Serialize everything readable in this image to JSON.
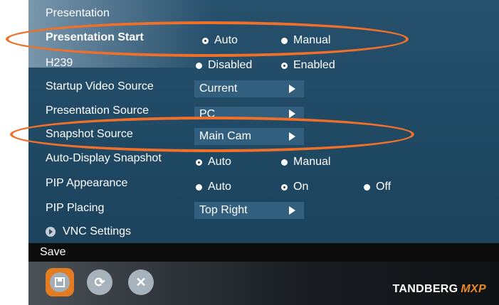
{
  "panel": {
    "title": "Presentation",
    "rows": [
      {
        "label": "Presentation Start",
        "bold": true,
        "options": [
          {
            "label": "Auto",
            "selected": true
          },
          {
            "label": "Manual",
            "selected": false
          }
        ]
      },
      {
        "label": "H239",
        "options": [
          {
            "label": "Disabled",
            "selected": false
          },
          {
            "label": "Enabled",
            "selected": true
          }
        ]
      },
      {
        "label": "Startup Video Source",
        "select": "Current"
      },
      {
        "label": "Presentation Source",
        "select": "PC"
      },
      {
        "label": "Snapshot Source",
        "select": "Main Cam"
      },
      {
        "label": "Auto-Display Snapshot",
        "options": [
          {
            "label": "Auto",
            "selected": true
          },
          {
            "label": "Manual",
            "selected": false
          }
        ]
      },
      {
        "label": "PIP Appearance",
        "options": [
          {
            "label": "Auto",
            "selected": false
          },
          {
            "label": "On",
            "selected": true
          },
          {
            "label": "Off",
            "selected": false
          }
        ]
      },
      {
        "label": "PIP Placing",
        "select": "Top Right"
      }
    ],
    "vnc_label": "VNC Settings"
  },
  "savebar": {
    "label": "Save"
  },
  "toolbar": {
    "icons": [
      "save-icon",
      "refresh-icon",
      "close-icon"
    ]
  },
  "brand": {
    "name": "TANDBERG",
    "suffix": "MXP"
  },
  "colors": {
    "highlight": "#f0702a",
    "brand_accent": "#e88a2a",
    "save_button": "#e37b20"
  }
}
